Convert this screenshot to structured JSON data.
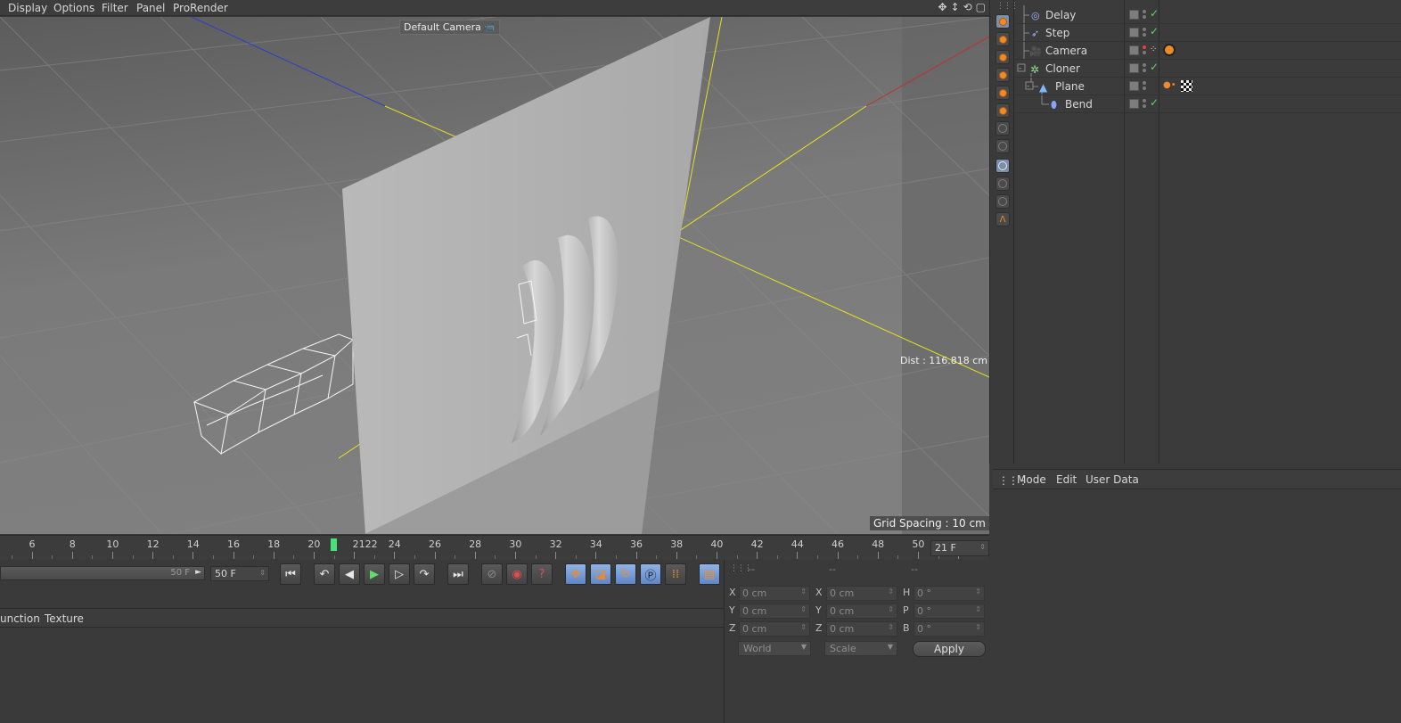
{
  "menu": {
    "items": [
      "Display",
      "Options",
      "Filter",
      "Panel",
      "ProRender"
    ]
  },
  "viewport": {
    "camera_label": "Default Camera",
    "dist_text": "Dist : 116.818 cm",
    "grid_text": "Grid Spacing : 10 cm"
  },
  "objects": [
    {
      "name": "Delay",
      "icon": "delay-effector-icon",
      "tick": "✓"
    },
    {
      "name": "Step",
      "icon": "step-effector-icon",
      "tick": "✓"
    },
    {
      "name": "Camera",
      "icon": "camera-icon",
      "tick": ""
    },
    {
      "name": "Cloner",
      "icon": "cloner-icon",
      "tick": "✓"
    },
    {
      "name": "Plane",
      "icon": "plane-icon",
      "tick": ""
    },
    {
      "name": "Bend",
      "icon": "bend-deformer-icon",
      "tick": "✓"
    }
  ],
  "attributes": {
    "tabs": [
      "Mode",
      "Edit",
      "User Data"
    ]
  },
  "timeline": {
    "ticks": [
      "6",
      "8",
      "10",
      "12",
      "14",
      "16",
      "18",
      "20",
      "2122",
      "24",
      "26",
      "28",
      "30",
      "32",
      "34",
      "36",
      "38",
      "40",
      "42",
      "44",
      "46",
      "48",
      "50"
    ],
    "current_frame": "21 F"
  },
  "transport": {
    "slider_value": "50 F",
    "end_frame": "50 F"
  },
  "material": {
    "tabs": [
      "unction",
      "Texture"
    ]
  },
  "coordinates": {
    "headers": [
      "--",
      "--",
      "--"
    ],
    "pos": [
      {
        "axis": "X",
        "value": "0 cm"
      },
      {
        "axis": "Y",
        "value": "0 cm"
      },
      {
        "axis": "Z",
        "value": "0 cm"
      }
    ],
    "size": [
      {
        "axis": "X",
        "value": "0 cm"
      },
      {
        "axis": "Y",
        "value": "0 cm"
      },
      {
        "axis": "Z",
        "value": "0 cm"
      }
    ],
    "rot": [
      {
        "axis": "H",
        "value": "0 °"
      },
      {
        "axis": "P",
        "value": "0 °"
      },
      {
        "axis": "B",
        "value": "0 °"
      }
    ],
    "space_select": "World",
    "mode_select": "Scale",
    "apply_label": "Apply"
  },
  "colors": {
    "accent": "#ee8a2a",
    "playhead": "#49e07a",
    "viewport_axis": "#e6e020"
  }
}
